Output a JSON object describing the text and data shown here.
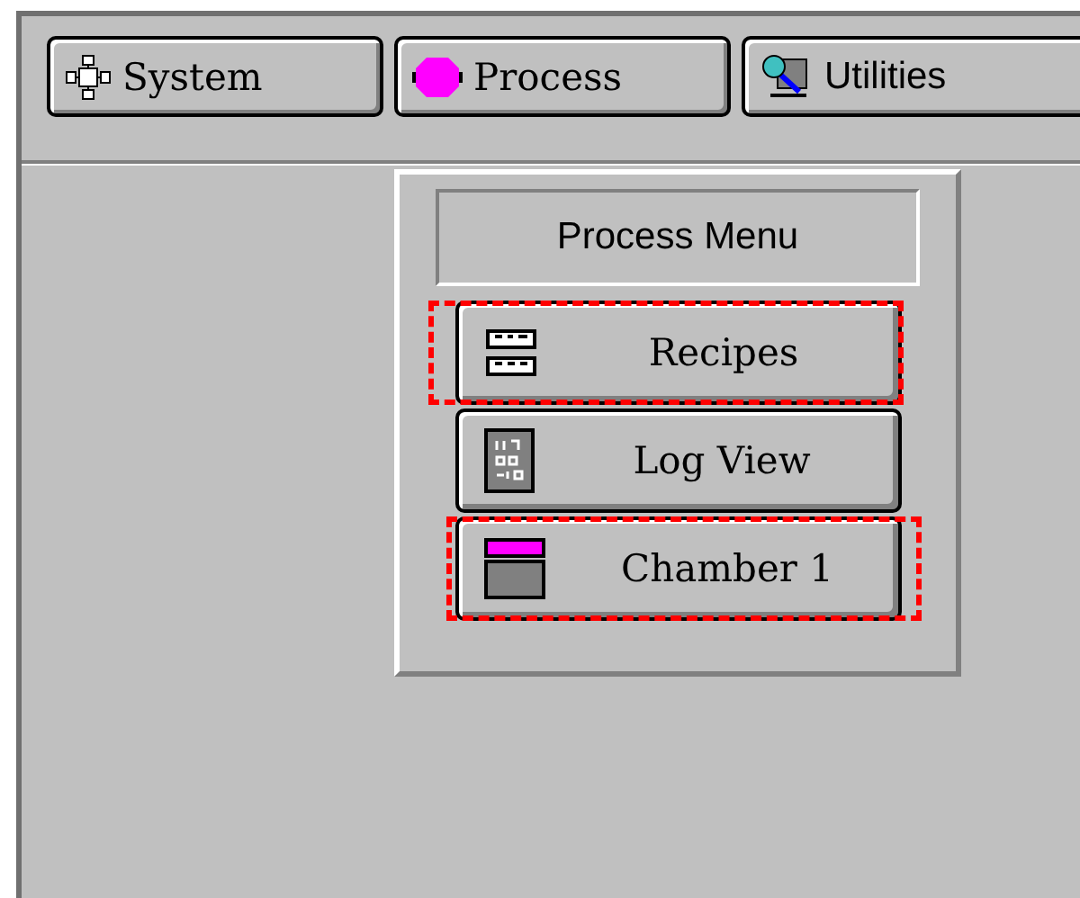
{
  "tabs": [
    {
      "label": "System"
    },
    {
      "label": "Process"
    },
    {
      "label": "Utilities"
    }
  ],
  "menu": {
    "title": "Process Menu",
    "items": [
      {
        "label": "Recipes",
        "highlighted": true
      },
      {
        "label": "Log View",
        "highlighted": false
      },
      {
        "label": "Chamber 1",
        "highlighted": true
      }
    ]
  }
}
